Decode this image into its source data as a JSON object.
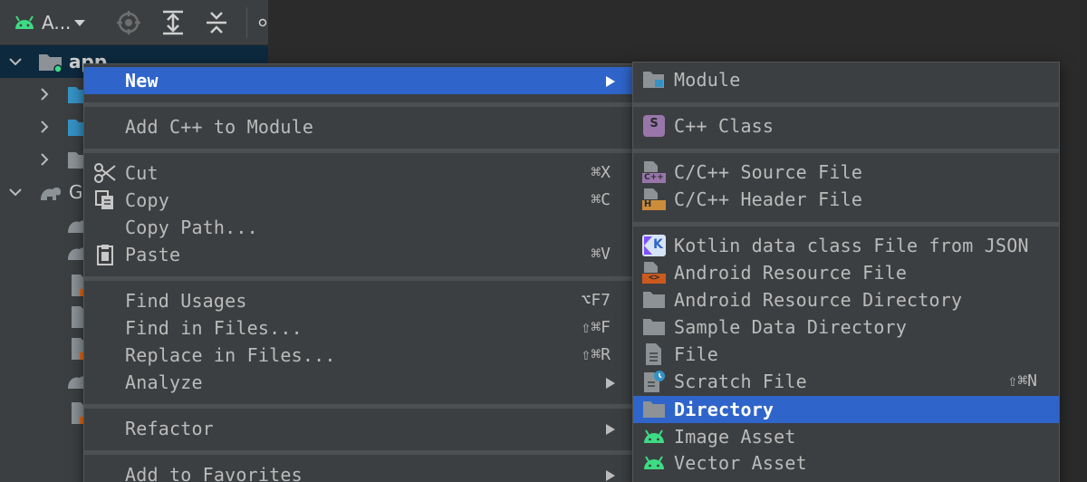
{
  "toolbar": {
    "project_label": "A..."
  },
  "tree": {
    "app_label": "app",
    "gradle_label": "Gi"
  },
  "context_menu": {
    "items": [
      {
        "label": "New"
      },
      {
        "label": "Add C++ to Module"
      },
      {
        "label": "Cut",
        "shortcut": "⌘X"
      },
      {
        "label": "Copy",
        "shortcut": "⌘C"
      },
      {
        "label": "Copy Path..."
      },
      {
        "label": "Paste",
        "shortcut": "⌘V"
      },
      {
        "label": "Find Usages",
        "shortcut": "⌥F7"
      },
      {
        "label": "Find in Files...",
        "shortcut": "⇧⌘F"
      },
      {
        "label": "Replace in Files...",
        "shortcut": "⇧⌘R"
      },
      {
        "label": "Analyze"
      },
      {
        "label": "Refactor"
      },
      {
        "label": "Add to Favorites"
      }
    ]
  },
  "new_submenu": {
    "items": [
      {
        "label": "Module",
        "icon": "module-icon"
      },
      {
        "label": "C++ Class",
        "icon": "cpp-class-icon",
        "badge": "S"
      },
      {
        "label": "C/C++ Source File",
        "icon": "cpp-source-file-icon",
        "badge": "C++"
      },
      {
        "label": "C/C++ Header File",
        "icon": "cpp-header-file-icon",
        "badge": "H"
      },
      {
        "label": "Kotlin data class File from JSON",
        "icon": "kotlin-json-icon",
        "badge": "K"
      },
      {
        "label": "Android Resource File",
        "icon": "android-resource-file-icon",
        "badge": "<>"
      },
      {
        "label": "Android Resource Directory",
        "icon": "folder-icon"
      },
      {
        "label": "Sample Data Directory",
        "icon": "folder-icon"
      },
      {
        "label": "File",
        "icon": "file-icon"
      },
      {
        "label": "Scratch File",
        "icon": "scratch-file-icon",
        "shortcut": "⇧⌘N"
      },
      {
        "label": "Directory",
        "icon": "folder-icon"
      },
      {
        "label": "Image Asset",
        "icon": "android-icon"
      },
      {
        "label": "Vector Asset",
        "icon": "android-icon"
      }
    ]
  },
  "colors": {
    "menu_bg": "#3c3f41",
    "highlight": "#2f65ca",
    "text": "#bbbbbb",
    "android_green": "#3ddc84",
    "kotlin_purple": "#7f52ff",
    "cpp_purple": "#9876aa",
    "header_orange": "#cc8c3a"
  }
}
